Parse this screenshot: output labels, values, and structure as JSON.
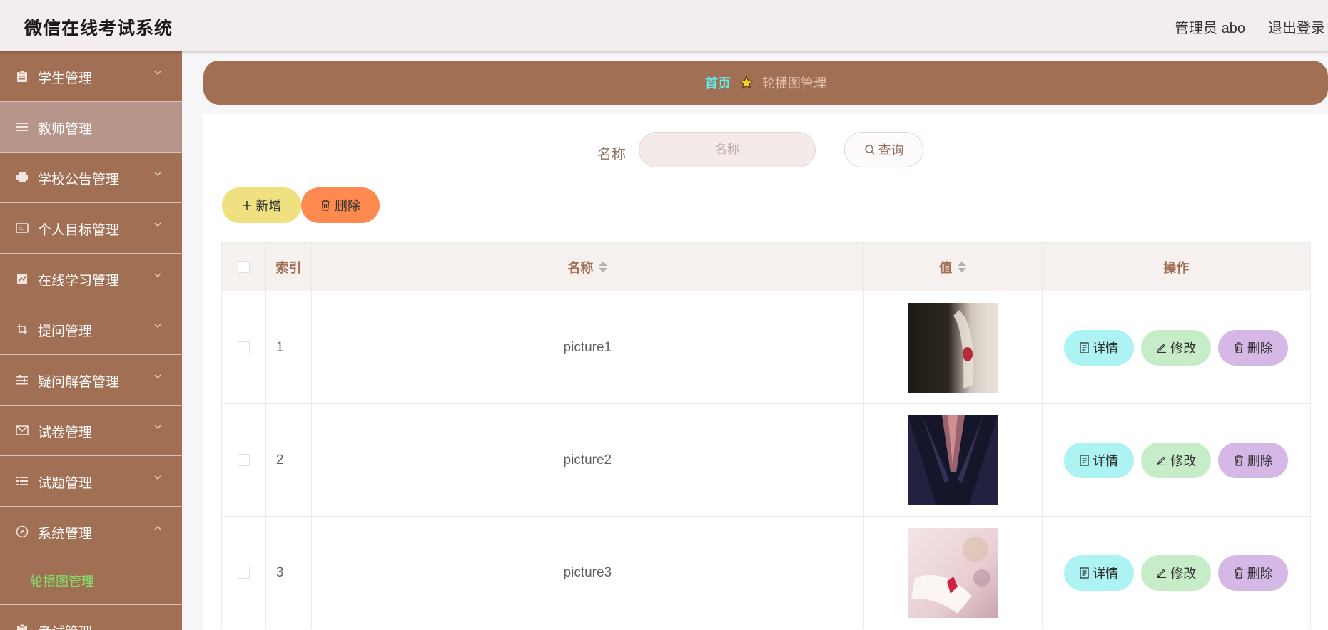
{
  "app": {
    "title": "微信在线考试系统"
  },
  "header": {
    "user": "管理员 abo",
    "logout": "退出登录"
  },
  "sidebar": {
    "items": [
      {
        "label": "学生管理",
        "icon": "clipboard-icon"
      },
      {
        "label": "教师管理",
        "icon": "list-icon"
      },
      {
        "label": "学校公告管理",
        "icon": "printer-icon"
      },
      {
        "label": "个人目标管理",
        "icon": "card-icon"
      },
      {
        "label": "在线学习管理",
        "icon": "chart-icon"
      },
      {
        "label": "提问管理",
        "icon": "crop-icon"
      },
      {
        "label": "疑问解答管理",
        "icon": "sliders-icon"
      },
      {
        "label": "试卷管理",
        "icon": "mail-icon"
      },
      {
        "label": "试题管理",
        "icon": "list-icon"
      },
      {
        "label": "系统管理",
        "icon": "compass-icon"
      }
    ],
    "sub_item": "轮播图管理",
    "last_item": "考试管理"
  },
  "breadcrumb": {
    "home": "首页",
    "current": "轮播图管理"
  },
  "search": {
    "label": "名称",
    "placeholder": "名称",
    "button": "查询"
  },
  "actions": {
    "add": "新增",
    "delete": "删除"
  },
  "table": {
    "headers": {
      "index": "索引",
      "name": "名称",
      "value": "值",
      "ops": "操作"
    },
    "rows": [
      {
        "index": "1",
        "name": "picture1"
      },
      {
        "index": "2",
        "name": "picture2"
      },
      {
        "index": "3",
        "name": "picture3"
      }
    ],
    "row_actions": {
      "detail": "详情",
      "edit": "修改",
      "delete": "删除"
    }
  },
  "colors": {
    "brand": "#a16f53",
    "home_link": "#5ff0f0",
    "active_sub": "#7fe66a"
  }
}
